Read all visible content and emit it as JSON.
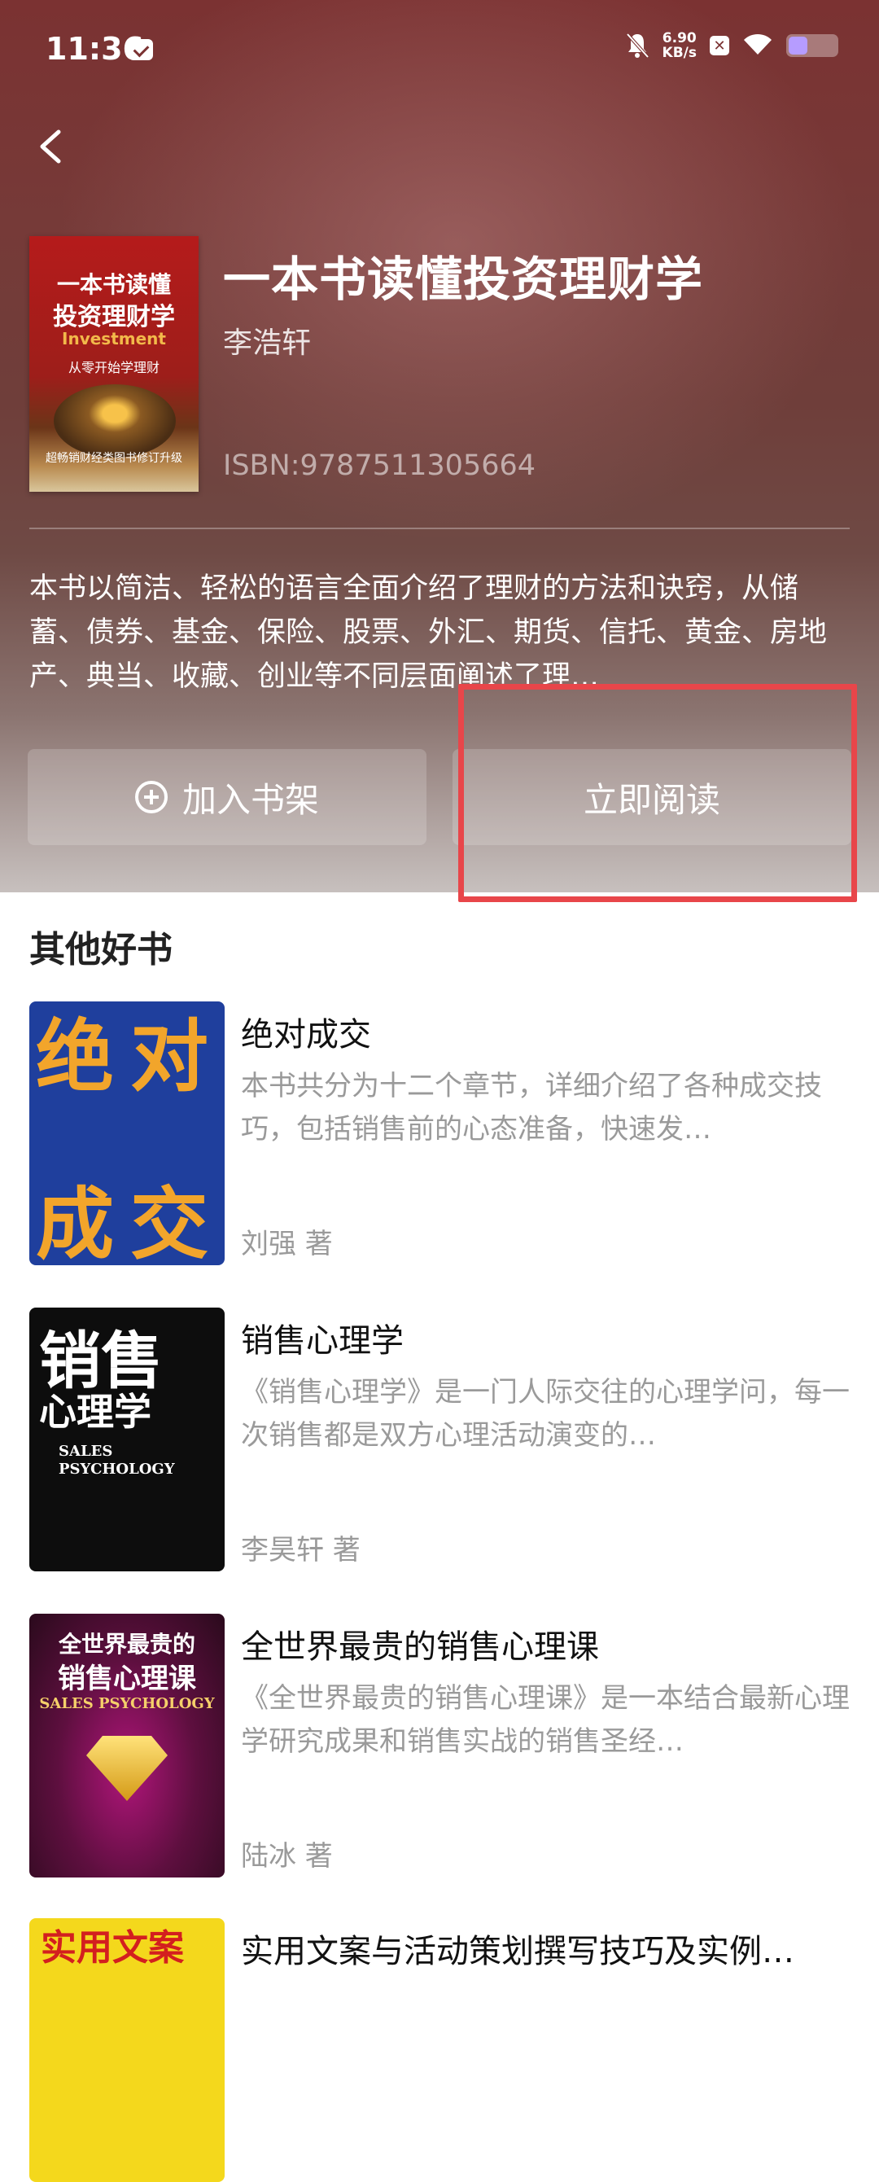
{
  "status_bar": {
    "time": "11:36",
    "net_speed_value": "6.90",
    "net_speed_unit": "KB/s",
    "battery_level": 0.4,
    "accent": "#b69cff"
  },
  "book": {
    "title": "一本书读懂投资理财学",
    "author": "李浩轩",
    "isbn": "ISBN:9787511305664",
    "description": "本书以简洁、轻松的语言全面介绍了理财的方法和诀窍，从储蓄、债券、基金、保险、股票、外汇、期货、信托、黄金、房地产、典当、收藏、创业等不同层面阐述了理…",
    "cover": {
      "line1": "一本书读懂",
      "line2": "投资理财学",
      "line3": "Investment",
      "line4": "从零开始学理财",
      "line5": "超畅销财经类图书修订升级"
    }
  },
  "actions": {
    "add_shelf_label": "加入书架",
    "read_now_label": "立即阅读",
    "highlight_color": "#e8464a"
  },
  "section": {
    "title": "其他好书"
  },
  "recommendations": [
    {
      "title": "绝对成交",
      "description": "本书共分为十二个章节，详细介绍了各种成交技巧，包括销售前的心态准备，快速发…",
      "author": "刘强 著",
      "cover_text": [
        "绝",
        "对",
        "成",
        "交"
      ]
    },
    {
      "title": "销售心理学",
      "description": "《销售心理学》是一门人际交往的心理学问，每一次销售都是双方心理活动演变的…",
      "author": "李昊轩 著",
      "cover_text": [
        "销售",
        "心理学",
        "SALES PSYCHOLOGY"
      ]
    },
    {
      "title": "全世界最贵的销售心理课",
      "description": "《全世界最贵的销售心理课》是一本结合最新心理学研究成果和销售实战的销售圣经…",
      "author": "陆冰 著",
      "cover_text": [
        "全世界最贵的",
        "销售心理课",
        "SALES PSYCHOLOGY"
      ]
    },
    {
      "title": "实用文案与活动策划撰写技巧及实例…",
      "cover_text": [
        "实用文案"
      ]
    }
  ]
}
